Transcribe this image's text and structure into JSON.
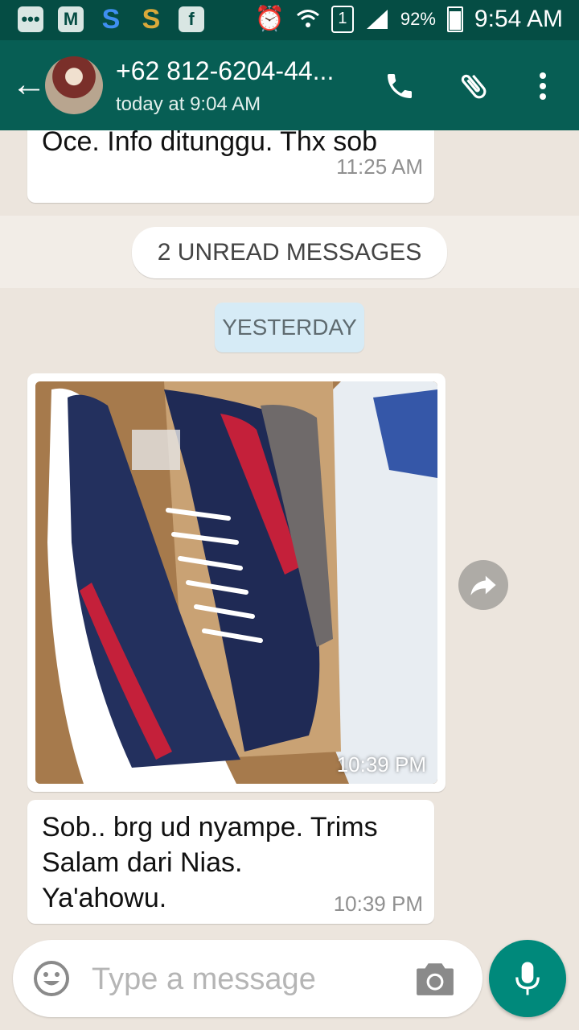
{
  "status_bar": {
    "battery": "92%",
    "time": "9:54 AM",
    "sim": "1"
  },
  "header": {
    "contact": "+62 812-6204-44...",
    "last_seen": "today at 9:04 AM"
  },
  "messages": [
    {
      "text": "Oce. Info ditunggu. Thx sob",
      "time": "11:25 AM"
    }
  ],
  "unread_label": "2 UNREAD MESSAGES",
  "date_label": "YESTERDAY",
  "photo_message": {
    "time": "10:39 PM"
  },
  "last_message": {
    "lines": [
      "Sob.. brg ud nyampe. Trims",
      "Salam dari Nias.",
      "Ya'ahowu."
    ],
    "time": "10:39 PM"
  },
  "composer": {
    "placeholder": "Type a message"
  },
  "colors": {
    "header": "#075e54",
    "status_bar": "#054d44",
    "fab": "#00897b",
    "date_pill": "#d6ebf6"
  }
}
